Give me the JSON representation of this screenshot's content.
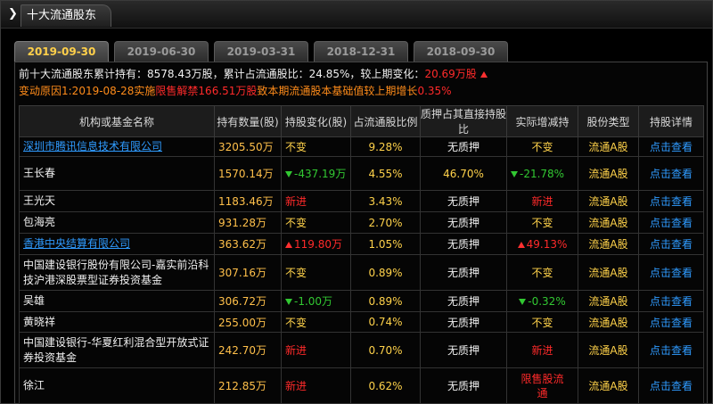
{
  "window": {
    "tab_title": "十大流通股东"
  },
  "tabs": [
    "2019-09-30",
    "2019-06-30",
    "2019-03-31",
    "2018-12-31",
    "2018-09-30"
  ],
  "summary": {
    "l1_a": "前十大流通股东累计持有：",
    "l1_b": "8578.43万股",
    "l1_c": "，累计占流通股比：",
    "l1_d": "24.85%",
    "l1_e": "，较上期变化：",
    "l1_f": "20.69万股",
    "l2_a": "变动原因1:2019-08-28实施",
    "l2_b": "限售解禁166.51万股",
    "l2_c": "致本期流通股本基础值较上期增长",
    "l2_d": "0.35%"
  },
  "columns": [
    "机构或基金名称",
    "持有数量(股)",
    "持股变化(股)",
    "占流通股比例",
    "质押占其直接持股比",
    "实际增减持",
    "股份类型",
    "持股详情"
  ],
  "rows": [
    {
      "name": "深圳市腾讯信息技术有限公司",
      "hold": "3205.50万",
      "change": "不变",
      "ratio": "9.28%",
      "pledge": "无质押",
      "actual": "不变",
      "type": "流通A股",
      "detail": "点击查看"
    },
    {
      "name": "王长春",
      "hold": "1570.14万",
      "change": "-437.19万",
      "ratio": "4.55%",
      "pledge": "46.70%",
      "actual": "-21.78%",
      "type": "流通A股",
      "detail": "点击查看"
    },
    {
      "name": "王光天",
      "hold": "1183.46万",
      "change": "新进",
      "ratio": "3.43%",
      "pledge": "无质押",
      "actual": "新进",
      "type": "流通A股",
      "detail": "点击查看"
    },
    {
      "name": "包海亮",
      "hold": "931.28万",
      "change": "不变",
      "ratio": "2.70%",
      "pledge": "无质押",
      "actual": "不变",
      "type": "流通A股",
      "detail": "点击查看"
    },
    {
      "name": "香港中央结算有限公司",
      "hold": "363.62万",
      "change": "119.80万",
      "ratio": "1.05%",
      "pledge": "无质押",
      "actual": "49.13%",
      "type": "流通A股",
      "detail": "点击查看"
    },
    {
      "name": "中国建设银行股份有限公司-嘉实前沿科技沪港深股票型证券投资基金",
      "hold": "307.16万",
      "change": "不变",
      "ratio": "0.89%",
      "pledge": "无质押",
      "actual": "不变",
      "type": "流通A股",
      "detail": "点击查看"
    },
    {
      "name": "吴雄",
      "hold": "306.72万",
      "change": "-1.00万",
      "ratio": "0.89%",
      "pledge": "无质押",
      "actual": "-0.32%",
      "type": "流通A股",
      "detail": "点击查看"
    },
    {
      "name": "黄晓祥",
      "hold": "255.00万",
      "change": "不变",
      "ratio": "0.74%",
      "pledge": "无质押",
      "actual": "不变",
      "type": "流通A股",
      "detail": "点击查看"
    },
    {
      "name": "中国建设银行-华夏红利混合型开放式证券投资基金",
      "hold": "242.70万",
      "change": "新进",
      "ratio": "0.70%",
      "pledge": "无质押",
      "actual": "新进",
      "type": "流通A股",
      "detail": "点击查看"
    },
    {
      "name": "徐江",
      "hold": "212.85万",
      "change": "新进",
      "ratio": "0.62%",
      "pledge": "无质押",
      "actual": "限售股流通",
      "type": "流通A股",
      "detail": "点击查看"
    }
  ],
  "colors": {
    "accent_yellow": "#ffd24a",
    "up_red": "#ff2a2a",
    "down_green": "#32c832",
    "link_blue": "#2f9bff",
    "new_red": "#ff2a2a"
  }
}
